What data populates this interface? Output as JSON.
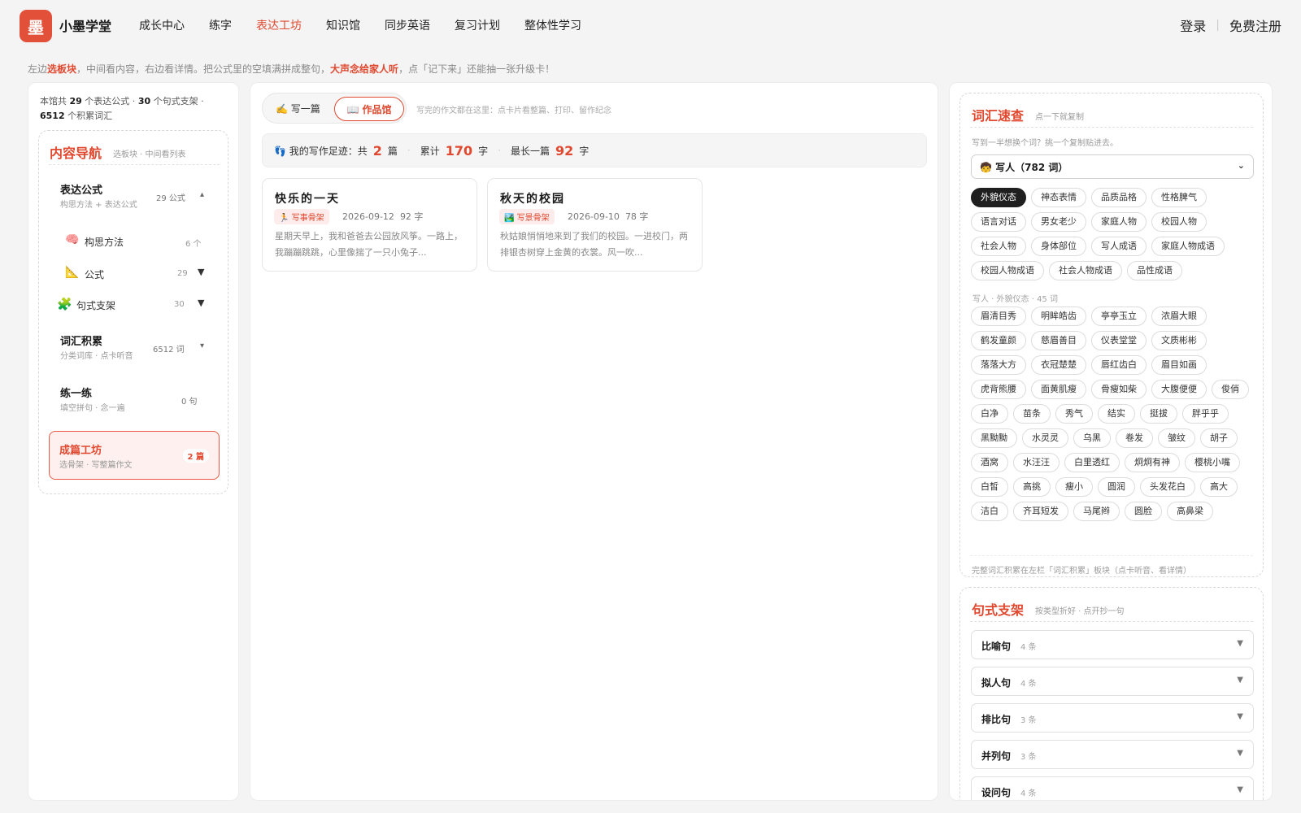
{
  "app": {
    "logo_char": "墨",
    "brand": "小墨学堂"
  },
  "nav": [
    {
      "label": "成长中心",
      "active": false
    },
    {
      "label": "练字",
      "active": false
    },
    {
      "label": "表达工坊",
      "active": true
    },
    {
      "label": "知识馆",
      "active": false
    },
    {
      "label": "同步英语",
      "active": false
    },
    {
      "label": "复习计划",
      "active": false
    },
    {
      "label": "整体性学习",
      "active": false
    }
  ],
  "auth": {
    "login": "登录",
    "separator": "|",
    "register": "免费注册"
  },
  "tipline": {
    "p1": "左边",
    "h1": "选板块",
    "p2": "，中间看内容，右边看详情。把公式里的空填满拼成整句，",
    "h2": "大声念给家人听",
    "p3": "，点「记下来」还能抽一张升级卡！"
  },
  "left": {
    "stats": {
      "p1": "本馆共 ",
      "n1": "29",
      "p2": " 个表达公式 · ",
      "n2": "30",
      "p3": " 个句式支架 · ",
      "n3": "6512",
      "p4": " 个积累词汇"
    },
    "nav_title": "内容导航",
    "nav_sub": "选板块 · 中间看列表",
    "items": {
      "formulas": {
        "title": "表达公式",
        "sub": "构思方法 + 表达公式",
        "count": "29 公式",
        "arrow": "▴"
      },
      "method": {
        "icon": "🧠",
        "label": "构思方法",
        "count": "6 个"
      },
      "formula": {
        "icon": "📐",
        "label": "公式",
        "count": "29",
        "arrow": "▼"
      },
      "frames": {
        "icon": "🧩",
        "label": "句式支架",
        "count": "30",
        "arrow": "▼"
      },
      "vocab": {
        "title": "词汇积累",
        "sub": "分类词库 · 点卡听音",
        "count": "6512 词",
        "arrow": "▾"
      },
      "practice": {
        "title": "练一练",
        "sub": "填空拼句 · 念一遍",
        "count": "0 句"
      },
      "workshop": {
        "title": "成篇工坊",
        "sub": "选骨架 · 写整篇作文",
        "badge": "2 篇"
      }
    }
  },
  "mid": {
    "tab_write": "✍️ 写一篇",
    "tab_gallery": "📖 作品馆",
    "tabs_note": "写完的作文都在这里：点卡片看整篇、打印、留作纪念",
    "footprint": {
      "label": "👣 我的写作足迹：共",
      "count": "2",
      "count_unit": "篇",
      "total_label": "累计",
      "total": "170",
      "total_unit": "字",
      "longest_label": "最长一篇",
      "longest": "92",
      "longest_unit": "字",
      "dot": "·"
    },
    "works": [
      {
        "title": "快乐的一天",
        "tag": "🏃 写事骨架",
        "date": "2026-09-12",
        "words": "92 字",
        "excerpt": "星期天早上，我和爸爸去公园放风筝。一路上，我蹦蹦跳跳，心里像揣了一只小兔子..."
      },
      {
        "title": "秋天的校园",
        "tag": "🏞️ 写景骨架",
        "date": "2026-09-10",
        "words": "78 字",
        "excerpt": "秋姑娘悄悄地来到了我们的校园。一进校门，两排银杏树穿上金黄的衣裳。风一吹..."
      }
    ]
  },
  "right": {
    "vocab": {
      "title": "词汇速查",
      "sub": "点一下就复制",
      "tip": "写到一半想换个词？挑一个复制贴进去。",
      "select_value": "🧒 写人（782 词）",
      "chevron": "⌄",
      "categories": [
        "外貌仪态",
        "神态表情",
        "品质品格",
        "性格脾气",
        "语言对话",
        "男女老少",
        "家庭人物",
        "校园人物",
        "社会人物",
        "身体部位",
        "写人成语",
        "家庭人物成语",
        "校园人物成语",
        "社会人物成语",
        "品性成语"
      ],
      "active_category": "外貌仪态",
      "words_label": "写人 · 外貌仪态 · 45 词",
      "words": [
        "眉清目秀",
        "明眸皓齿",
        "亭亭玉立",
        "浓眉大眼",
        "鹤发童颜",
        "慈眉善目",
        "仪表堂堂",
        "文质彬彬",
        "落落大方",
        "衣冠楚楚",
        "唇红齿白",
        "眉目如画",
        "虎背熊腰",
        "面黄肌瘦",
        "骨瘦如柴",
        "大腹便便",
        "俊俏",
        "白净",
        "苗条",
        "秀气",
        "结实",
        "挺拔",
        "胖乎乎",
        "黑黝黝",
        "水灵灵",
        "乌黑",
        "卷发",
        "皱纹",
        "胡子",
        "酒窝",
        "水汪汪",
        "白里透红",
        "炯炯有神",
        "樱桃小嘴",
        "白皙",
        "高挑",
        "瘦小",
        "圆润",
        "头发花白",
        "高大",
        "洁白",
        "齐耳短发",
        "马尾辫",
        "圆脸",
        "高鼻梁"
      ],
      "footer": "完整词汇积累在左栏「词汇积累」板块（点卡听音、看详情）"
    },
    "frames": {
      "title": "句式支架",
      "sub": "按类型折好 · 点开抄一句",
      "rows": [
        {
          "name": "比喻句",
          "count": "4 条",
          "arrow": "▼"
        },
        {
          "name": "拟人句",
          "count": "4 条",
          "arrow": "▼"
        },
        {
          "name": "排比句",
          "count": "3 条",
          "arrow": "▼"
        },
        {
          "name": "并列句",
          "count": "3 条",
          "arrow": "▼"
        },
        {
          "name": "设问句",
          "count": "4 条",
          "arrow": "▼"
        }
      ]
    }
  },
  "colors": {
    "accent": "#e0492f",
    "logo_bg": "#e2503a",
    "chip_active": "#1f1f1f",
    "workshop_bg": "#fdf0ee"
  }
}
